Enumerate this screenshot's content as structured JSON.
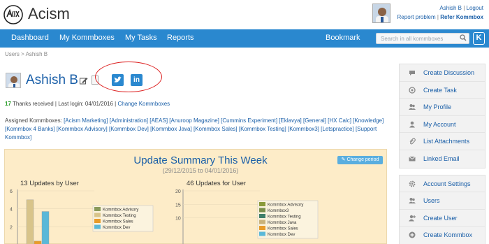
{
  "header": {
    "app_name": "Acism",
    "logo_text": "ACISM",
    "user_name": "Ashish B",
    "separator": "|",
    "logout": "Logout",
    "report_problem": "Report problem",
    "refer": "Refer Kommbox"
  },
  "nav": {
    "items": [
      "Dashboard",
      "My Kommboxes",
      "My Tasks",
      "Reports"
    ],
    "bookmark": "Bookmark",
    "search_placeholder": "Search in all kommboxes",
    "k_label": "K"
  },
  "breadcrumb": "Users > Ashish B",
  "profile": {
    "name": "Ashish B",
    "linkedin_label": "in",
    "thanks_count": "17",
    "thanks_text": "Thanks received | Last login: 04/01/2016 |",
    "change_link": "Change Kommboxes",
    "assigned_label": "Assigned Kommboxes:",
    "assigned": [
      "[Acism Marketing]",
      "[Administration]",
      "[AEAS]",
      "[Anuroop Magazine]",
      "[Cummins Experiment]",
      "[Eklavya]",
      "[General]",
      "[HX Calc]",
      "[Knowledge]",
      "[Kommbox 4 Banks]",
      "[Kommbox Advisory]",
      "[Kommbox Dev]",
      "[Kommbox Java]",
      "[Kommbox Sales]",
      "[Kommbox Testing]",
      "[Kommbox3]",
      "[Letspractice]",
      "[Support Kommbox]"
    ]
  },
  "summary": {
    "title": "Update Summary This Week",
    "range": "(29/12/2015 to 04/01/2016)",
    "change_period": "Change period"
  },
  "chart_data": [
    {
      "type": "bar",
      "title": "13 Updates by User",
      "ylim": [
        0,
        6
      ],
      "yticks": [
        "6",
        "4",
        "2"
      ],
      "series": [
        {
          "name": "Kommbox Advisory",
          "color": "#8a9a5b",
          "values": [
            0
          ]
        },
        {
          "name": "Kommbox Testing",
          "color": "#d8c48a",
          "values": [
            5
          ]
        },
        {
          "name": "Kommbox Sales",
          "color": "#e89c2a",
          "values": [
            0.4
          ]
        },
        {
          "name": "Kommbox Dev",
          "color": "#5ab8d8",
          "values": [
            3.7
          ]
        }
      ]
    },
    {
      "type": "bar",
      "title": "46 Updates for User",
      "ylim": [
        0,
        20
      ],
      "yticks": [
        "20",
        "15",
        "10"
      ],
      "series": [
        {
          "name": "Kommbox Advisory",
          "color": "#8a9a3a",
          "values": [
            0
          ]
        },
        {
          "name": "Kommbox3",
          "color": "#7a8f4a",
          "values": [
            0
          ]
        },
        {
          "name": "Kommbox Testing",
          "color": "#3f7f6a",
          "values": [
            0
          ]
        },
        {
          "name": "Kommbox Java",
          "color": "#c9b27a",
          "values": [
            0
          ]
        },
        {
          "name": "Kommbox Sales",
          "color": "#e89c2a",
          "values": [
            0
          ]
        },
        {
          "name": "Kommbox Dev",
          "color": "#5ab8d8",
          "values": [
            0
          ]
        }
      ]
    }
  ],
  "sidebar": {
    "group1": [
      {
        "label": "Create Discussion",
        "icon": "chat-icon"
      },
      {
        "label": "Create Task",
        "icon": "target-icon"
      },
      {
        "label": "My Profile",
        "icon": "users-icon"
      },
      {
        "label": "My Account",
        "icon": "user-icon"
      },
      {
        "label": "List Attachments",
        "icon": "paperclip-icon"
      },
      {
        "label": "Linked Email",
        "icon": "email-icon"
      }
    ],
    "group2": [
      {
        "label": "Account Settings",
        "icon": "gear-icon"
      },
      {
        "label": "Users",
        "icon": "users-icon"
      },
      {
        "label": "Create User",
        "icon": "user-plus-icon"
      },
      {
        "label": "Create Kommbox",
        "icon": "plus-circle-icon"
      }
    ]
  },
  "colors": {
    "nav": "#2a88cf",
    "link": "#1a5fa8",
    "panel": "#fdecc8",
    "highlight": "#d22222"
  }
}
